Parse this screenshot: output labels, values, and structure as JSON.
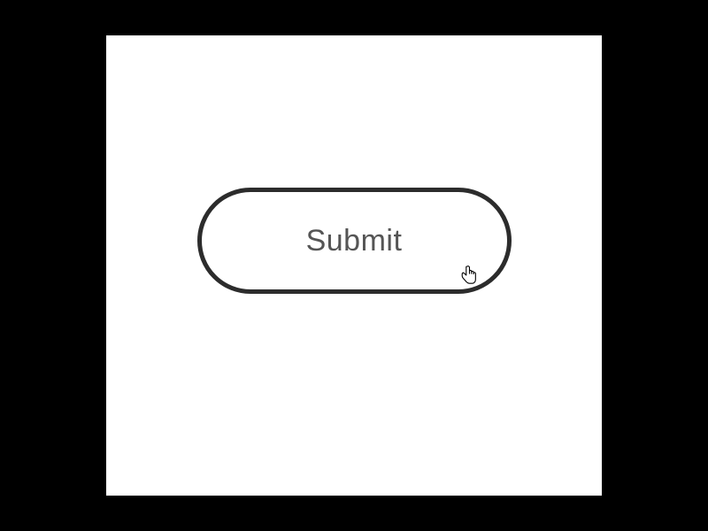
{
  "button": {
    "label": "Submit"
  }
}
